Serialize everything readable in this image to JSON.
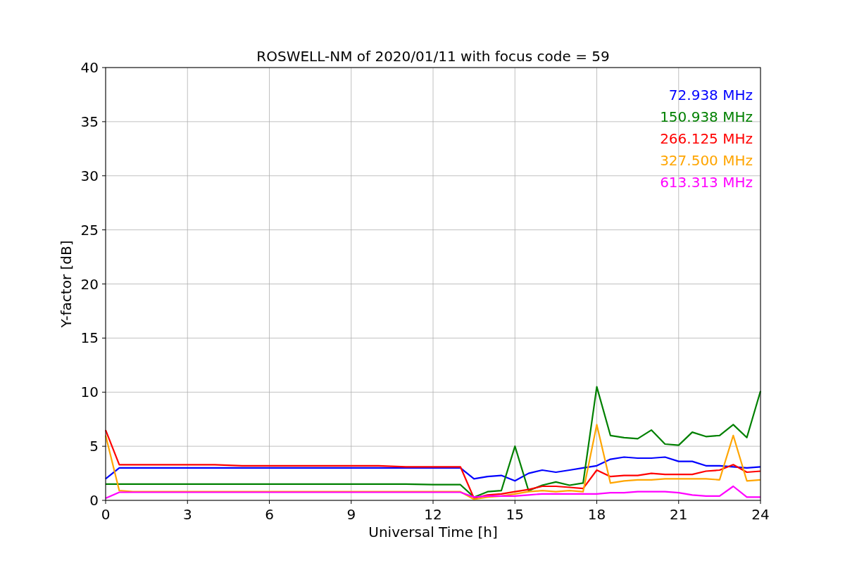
{
  "chart_data": {
    "type": "line",
    "title": "ROSWELL-NM of 2020/01/11 with focus code = 59",
    "xlabel": "Universal Time [h]",
    "ylabel": "Y-factor [dB]",
    "x": [
      0,
      0.5,
      1,
      2,
      3,
      4,
      5,
      6,
      7,
      8,
      9,
      10,
      11,
      12,
      13,
      13.5,
      14,
      14.5,
      15,
      15.5,
      16,
      16.5,
      17,
      17.5,
      18,
      18.5,
      19,
      19.5,
      20,
      20.5,
      21,
      21.5,
      22,
      22.5,
      23,
      23.5,
      24
    ],
    "series": [
      {
        "name": "72.938 MHz",
        "color": "#0000ff",
        "values": [
          2,
          3,
          3,
          3,
          3,
          3,
          3,
          3,
          3,
          3,
          3,
          3,
          3,
          3,
          3,
          2.0,
          2.2,
          2.3,
          1.8,
          2.5,
          2.8,
          2.6,
          2.8,
          3.0,
          3.2,
          3.8,
          4.0,
          3.9,
          3.9,
          4.0,
          3.6,
          3.6,
          3.2,
          3.2,
          3.1,
          3.0,
          3.1
        ]
      },
      {
        "name": "150.938 MHz",
        "color": "#008000",
        "values": [
          1.5,
          1.5,
          1.5,
          1.5,
          1.5,
          1.5,
          1.5,
          1.5,
          1.5,
          1.5,
          1.5,
          1.5,
          1.5,
          1.45,
          1.45,
          0.3,
          0.8,
          0.9,
          5.0,
          0.9,
          1.4,
          1.7,
          1.4,
          1.6,
          10.5,
          6.0,
          5.8,
          5.7,
          6.5,
          5.2,
          5.1,
          6.3,
          5.9,
          6.0,
          7.0,
          5.8,
          10.1
        ]
      },
      {
        "name": "266.125 MHz",
        "color": "#ff0000",
        "values": [
          6.5,
          3.3,
          3.3,
          3.3,
          3.3,
          3.3,
          3.2,
          3.2,
          3.2,
          3.2,
          3.2,
          3.2,
          3.1,
          3.1,
          3.1,
          0.2,
          0.5,
          0.6,
          0.8,
          1.0,
          1.3,
          1.3,
          1.2,
          1.1,
          2.8,
          2.2,
          2.3,
          2.3,
          2.5,
          2.4,
          2.4,
          2.4,
          2.7,
          2.8,
          3.3,
          2.6,
          2.7
        ]
      },
      {
        "name": "327.500 MHz",
        "color": "#ffa500",
        "values": [
          6,
          0.9,
          0.8,
          0.8,
          0.8,
          0.8,
          0.8,
          0.8,
          0.8,
          0.8,
          0.8,
          0.8,
          0.8,
          0.8,
          0.8,
          0.1,
          0.3,
          0.4,
          0.6,
          0.8,
          0.9,
          0.8,
          0.9,
          0.8,
          7.0,
          1.6,
          1.8,
          1.9,
          1.9,
          2.0,
          2.0,
          2.0,
          2.0,
          1.9,
          6.0,
          1.8,
          1.9
        ]
      },
      {
        "name": "613.313 MHz",
        "color": "#ff00ff",
        "values": [
          0.2,
          0.75,
          0.75,
          0.75,
          0.75,
          0.75,
          0.75,
          0.75,
          0.75,
          0.75,
          0.75,
          0.75,
          0.75,
          0.75,
          0.75,
          0.3,
          0.4,
          0.4,
          0.4,
          0.5,
          0.6,
          0.6,
          0.6,
          0.6,
          0.6,
          0.7,
          0.7,
          0.8,
          0.8,
          0.8,
          0.7,
          0.5,
          0.4,
          0.4,
          1.3,
          0.3,
          0.3
        ]
      }
    ],
    "grid": true,
    "xlim": [
      0,
      24
    ],
    "ylim": [
      0,
      40
    ],
    "xticks": [
      0,
      3,
      6,
      9,
      12,
      15,
      18,
      21,
      24
    ],
    "yticks": [
      0,
      5,
      10,
      15,
      20,
      25,
      30,
      35,
      40
    ]
  }
}
